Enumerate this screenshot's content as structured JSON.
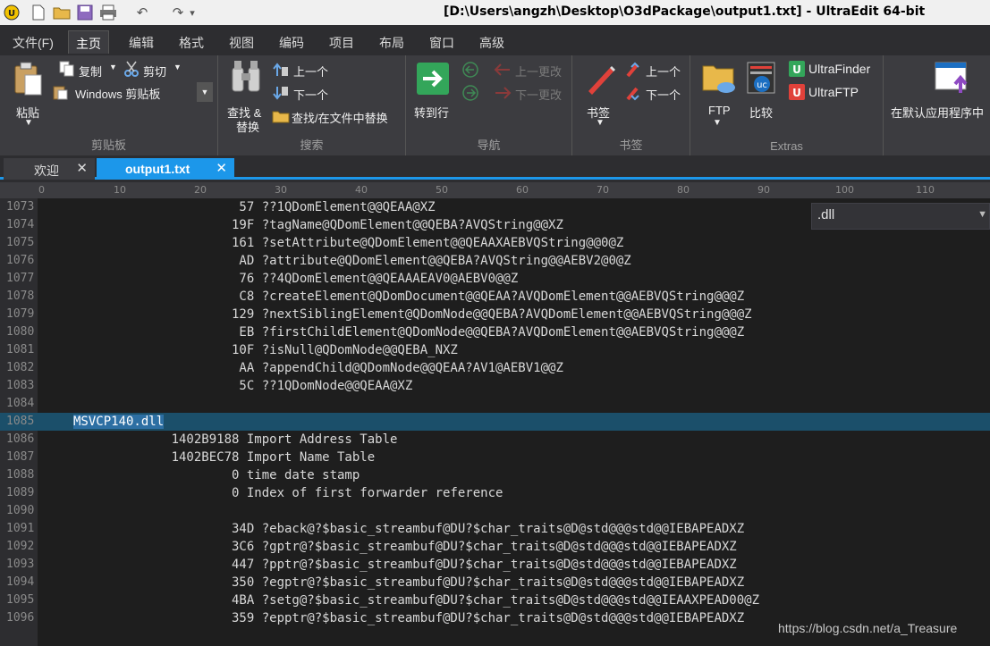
{
  "window": {
    "title": "[D:\\Users\\angzh\\Desktop\\O3dPackage\\output1.txt] - UltraEdit 64-bit"
  },
  "quick_access": [
    "app-logo-icon",
    "new-file-icon",
    "open-folder-icon",
    "save-icon",
    "print-icon",
    "undo-icon",
    "redo-icon",
    "customize-icon"
  ],
  "menu_tabs": [
    "文件(F)",
    "主页",
    "编辑",
    "格式",
    "视图",
    "编码",
    "项目",
    "布局",
    "窗口",
    "高级"
  ],
  "active_menu_tab": "主页",
  "ribbon": {
    "clipboard": {
      "paste": "粘贴",
      "copy": "复制",
      "cut": "剪切",
      "clipboard_select": "Windows 剪贴板",
      "group_label": "剪贴板"
    },
    "search": {
      "find_replace_line1": "查找 &",
      "find_replace_line2": "替换",
      "up": "上一个",
      "down": "下一个",
      "find_in_files": "查找/在文件中替换",
      "group_label": "搜索"
    },
    "navigation": {
      "goto": "转到行",
      "prev_change": "上一更改",
      "next_change": "下一更改",
      "group_label": "导航"
    },
    "bookmarks": {
      "bookmark": "书签",
      "up": "上一个",
      "down": "下一个",
      "group_label": "书签"
    },
    "extras": {
      "ftp": "FTP",
      "compare": "比较",
      "ultrafinder": "UltraFinder",
      "ultraftp": "UltraFTP",
      "open_default": "在默认应用程序中",
      "group_label": "Extras"
    }
  },
  "doc_tabs": [
    {
      "label": "欢迎",
      "active": false
    },
    {
      "label": "output1.txt",
      "active": true
    }
  ],
  "ruler_ticks": [
    "0",
    "10",
    "20",
    "30",
    "40",
    "50",
    "60",
    "70",
    "80",
    "90",
    "100",
    "110"
  ],
  "find_box": {
    "value": ".dll"
  },
  "lines": [
    {
      "num": "1073",
      "text": "                      57 ??1QDomElement@@QEAA@XZ"
    },
    {
      "num": "1074",
      "text": "                     19F ?tagName@QDomElement@@QEBA?AVQString@@XZ"
    },
    {
      "num": "1075",
      "text": "                     161 ?setAttribute@QDomElement@@QEAAXAEBVQString@@0@Z"
    },
    {
      "num": "1076",
      "text": "                      AD ?attribute@QDomElement@@QEBA?AVQString@@AEBV2@0@Z"
    },
    {
      "num": "1077",
      "text": "                      76 ??4QDomElement@@QEAAAEAV0@AEBV0@@Z"
    },
    {
      "num": "1078",
      "text": "                      C8 ?createElement@QDomDocument@@QEAA?AVQDomElement@@AEBVQString@@@Z"
    },
    {
      "num": "1079",
      "text": "                     129 ?nextSiblingElement@QDomNode@@QEBA?AVQDomElement@@AEBVQString@@@Z"
    },
    {
      "num": "1080",
      "text": "                      EB ?firstChildElement@QDomNode@@QEBA?AVQDomElement@@AEBVQString@@@Z"
    },
    {
      "num": "1081",
      "text": "                     10F ?isNull@QDomNode@@QEBA_NXZ"
    },
    {
      "num": "1082",
      "text": "                      AA ?appendChild@QDomNode@@QEAA?AV1@AEBV1@@Z"
    },
    {
      "num": "1083",
      "text": "                      5C ??1QDomNode@@QEAA@XZ"
    },
    {
      "num": "1084",
      "text": ""
    },
    {
      "num": "1085",
      "text": "MSVCP140.dll",
      "highlight": true
    },
    {
      "num": "1086",
      "text": "             1402B9188 Import Address Table"
    },
    {
      "num": "1087",
      "text": "             1402BEC78 Import Name Table"
    },
    {
      "num": "1088",
      "text": "                     0 time date stamp"
    },
    {
      "num": "1089",
      "text": "                     0 Index of first forwarder reference"
    },
    {
      "num": "1090",
      "text": ""
    },
    {
      "num": "1091",
      "text": "                     34D ?eback@?$basic_streambuf@DU?$char_traits@D@std@@@std@@IEBAPEADXZ"
    },
    {
      "num": "1092",
      "text": "                     3C6 ?gptr@?$basic_streambuf@DU?$char_traits@D@std@@@std@@IEBAPEADXZ"
    },
    {
      "num": "1093",
      "text": "                     447 ?pptr@?$basic_streambuf@DU?$char_traits@D@std@@@std@@IEBAPEADXZ"
    },
    {
      "num": "1094",
      "text": "                     350 ?egptr@?$basic_streambuf@DU?$char_traits@D@std@@@std@@IEBAPEADXZ"
    },
    {
      "num": "1095",
      "text": "                     4BA ?setg@?$basic_streambuf@DU?$char_traits@D@std@@@std@@IEAAXPEAD00@Z"
    },
    {
      "num": "1096",
      "text": "                     359 ?epptr@?$basic_streambuf@DU?$char_traits@D@std@@@std@@IEBAPEADXZ"
    }
  ],
  "watermark": "https://blog.csdn.net/a_Treasure",
  "colors": {
    "accent": "#1c97ea",
    "highlight_line": "#1b4f6a",
    "editor_bg": "#1e1e1e"
  }
}
